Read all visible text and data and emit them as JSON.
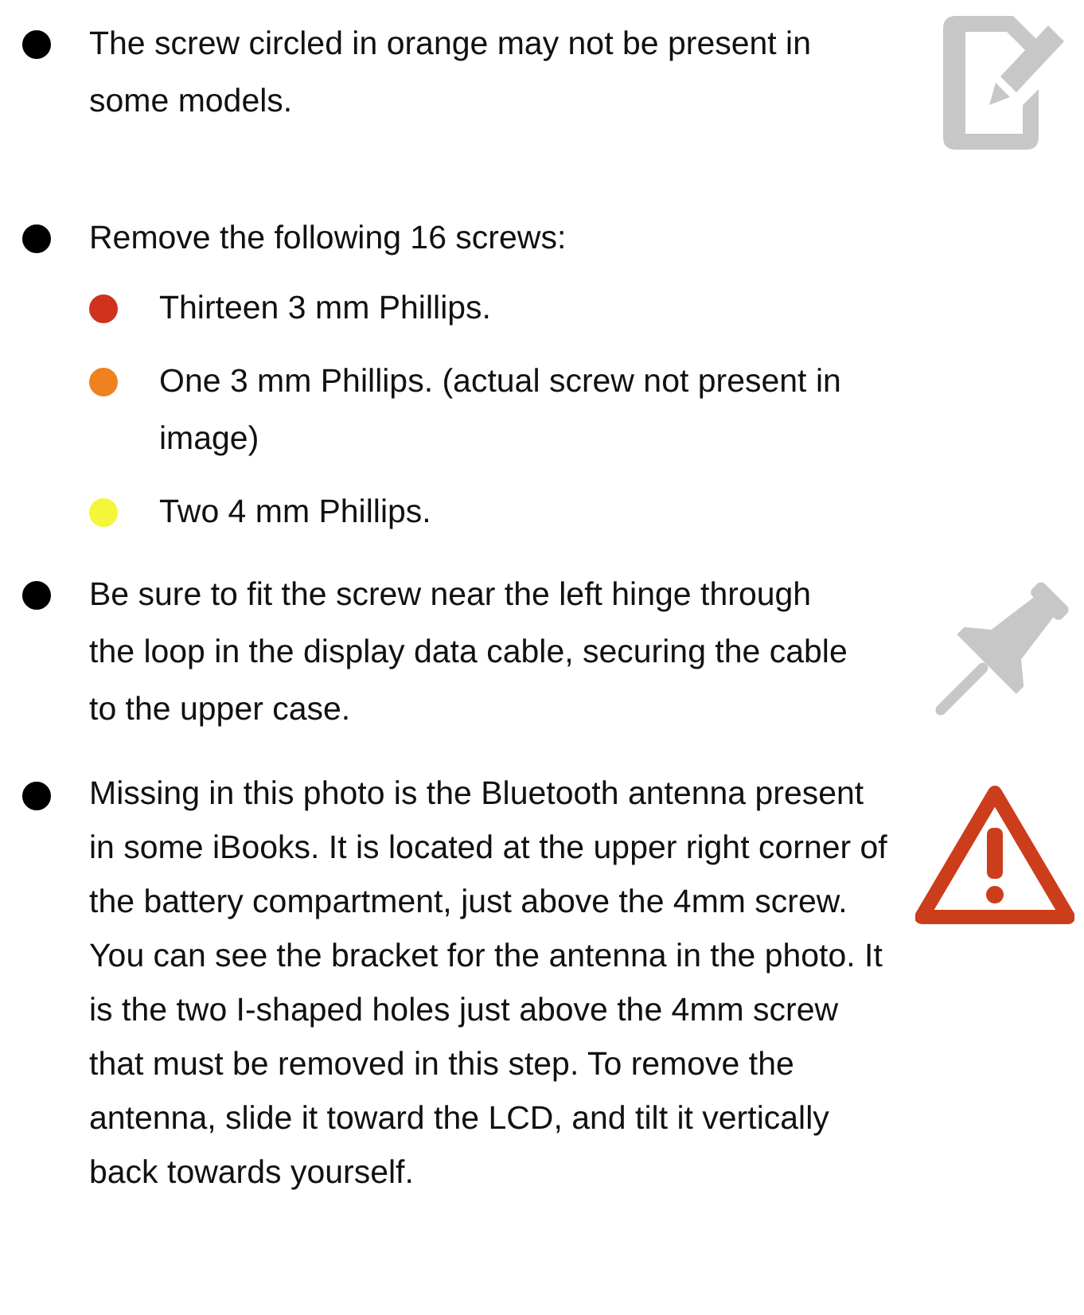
{
  "steps": [
    {
      "kind": "note",
      "text": "The screw circled in orange may not be present in some models."
    },
    {
      "kind": "plain",
      "text": "Remove the following 16 screws:",
      "children": [
        {
          "color": "#d0321e",
          "text": "Thirteen 3 mm Phillips."
        },
        {
          "color": "#f0811f",
          "text": "One 3 mm Phillips. (actual screw not present in image)"
        },
        {
          "color": "#f5f53a",
          "text": "Two 4 mm Phillips."
        }
      ]
    },
    {
      "kind": "reminder",
      "text": "Be sure to fit the screw near the left hinge through the loop in the display data cable, securing the cable to the upper case."
    },
    {
      "kind": "caution",
      "text": "Missing in this photo is the Bluetooth antenna present in some iBooks. It is located at the upper right corner of the battery compartment, just above the 4mm screw. You can see the bracket for the antenna in the photo. It is the two I-shaped holes just above the 4mm screw that must be removed in this step. To remove the antenna, slide it toward the LCD, and tilt it vertically back towards yourself."
    }
  ]
}
